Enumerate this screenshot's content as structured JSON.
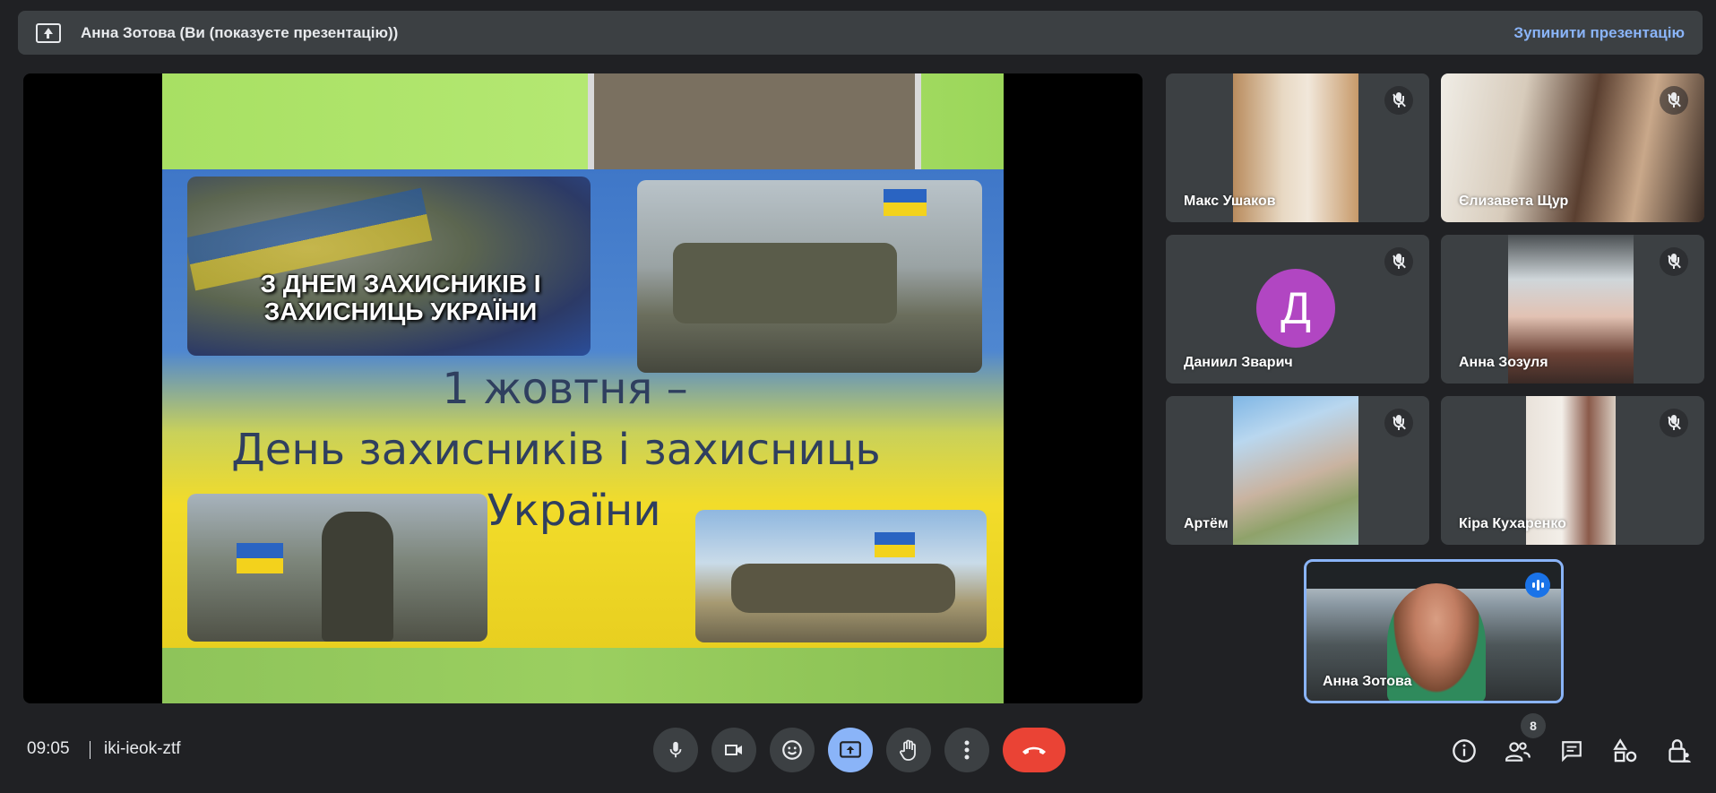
{
  "banner": {
    "presenter_text": "Анна Зотова (Ви (показуєте презентацію))",
    "stop_label": "Зупинити презентацію"
  },
  "slide": {
    "photo_caption": "З ДНЕМ ЗАХИСНИКІВ І ЗАХИСНИЦЬ УКРАЇНИ",
    "line1": "1 жовтня –",
    "line2": "День захисників і захисниць",
    "line3": "України"
  },
  "participants": [
    {
      "name": "Макс Ушаков",
      "muted": true
    },
    {
      "name": "Єлизавета Щур",
      "muted": true
    },
    {
      "name": "Даниил Зварич",
      "muted": true,
      "avatar_letter": "Д",
      "avatar_color": "#b146c2"
    },
    {
      "name": "Анна Зозуля",
      "muted": true
    },
    {
      "name": "Артём",
      "muted": true
    },
    {
      "name": "Кіра Кухаренко",
      "muted": true
    }
  ],
  "self": {
    "name": "Анна Зотова",
    "speaking": true
  },
  "bottom": {
    "time": "09:05",
    "meeting_code": "iki-ieok-ztf",
    "participant_count": "8"
  },
  "controls": {
    "mic": "mic-icon",
    "camera": "camera-icon",
    "reactions": "emoji-icon",
    "present": "present-icon",
    "raise_hand": "hand-icon",
    "more": "more-vert-icon",
    "leave": "call-end-icon"
  },
  "colors": {
    "background": "#202124",
    "surface": "#3c4043",
    "accent": "#8ab4f8",
    "end_call": "#ea4335",
    "avatar": "#b146c2"
  }
}
